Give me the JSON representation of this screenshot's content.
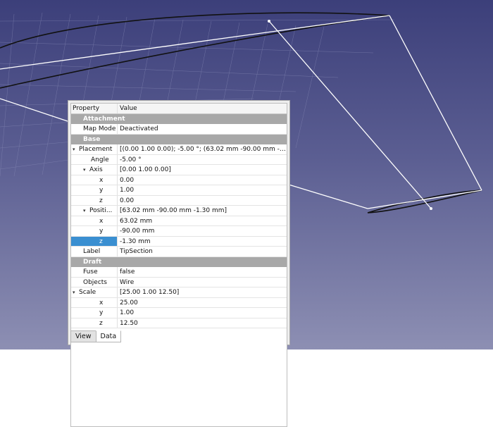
{
  "header": {
    "property": "Property",
    "value": "Value"
  },
  "groups": {
    "attachment": "Attachment",
    "base": "Base",
    "draft": "Draft"
  },
  "rows": {
    "map_mode": {
      "label": "Map Mode",
      "value": "Deactivated"
    },
    "placement": {
      "label": "Placement",
      "value": "[(0.00 1.00 0.00); -5.00 °; (63.02 mm  -90.00 mm  -1...."
    },
    "angle": {
      "label": "Angle",
      "value": "-5.00 °"
    },
    "axis": {
      "label": "Axis",
      "value": "[0.00 1.00 0.00]"
    },
    "axis_x": {
      "label": "x",
      "value": "0.00"
    },
    "axis_y": {
      "label": "y",
      "value": "1.00"
    },
    "axis_z": {
      "label": "z",
      "value": "0.00"
    },
    "position": {
      "label": "Positi...",
      "value": "[63.02 mm  -90.00 mm  -1.30 mm]"
    },
    "pos_x": {
      "label": "x",
      "value": "63.02 mm"
    },
    "pos_y": {
      "label": "y",
      "value": "-90.00 mm"
    },
    "pos_z": {
      "label": "z",
      "value": "-1.30 mm"
    },
    "label": {
      "label": "Label",
      "value": "TipSection"
    },
    "fuse": {
      "label": "Fuse",
      "value": "false"
    },
    "objects": {
      "label": "Objects",
      "value": "Wire"
    },
    "scale": {
      "label": "Scale",
      "value": "[25.00 1.00 12.50]"
    },
    "scale_x": {
      "label": "x",
      "value": "25.00"
    },
    "scale_y": {
      "label": "y",
      "value": "1.00"
    },
    "scale_z": {
      "label": "z",
      "value": "12.50"
    }
  },
  "tabs": [
    "View",
    "Data"
  ],
  "colors": {
    "selection": "#3a8fd1",
    "group_header": "#a8a8a8",
    "viewport_top": "#3c3f7a",
    "viewport_bottom": "#8d8fb3"
  }
}
